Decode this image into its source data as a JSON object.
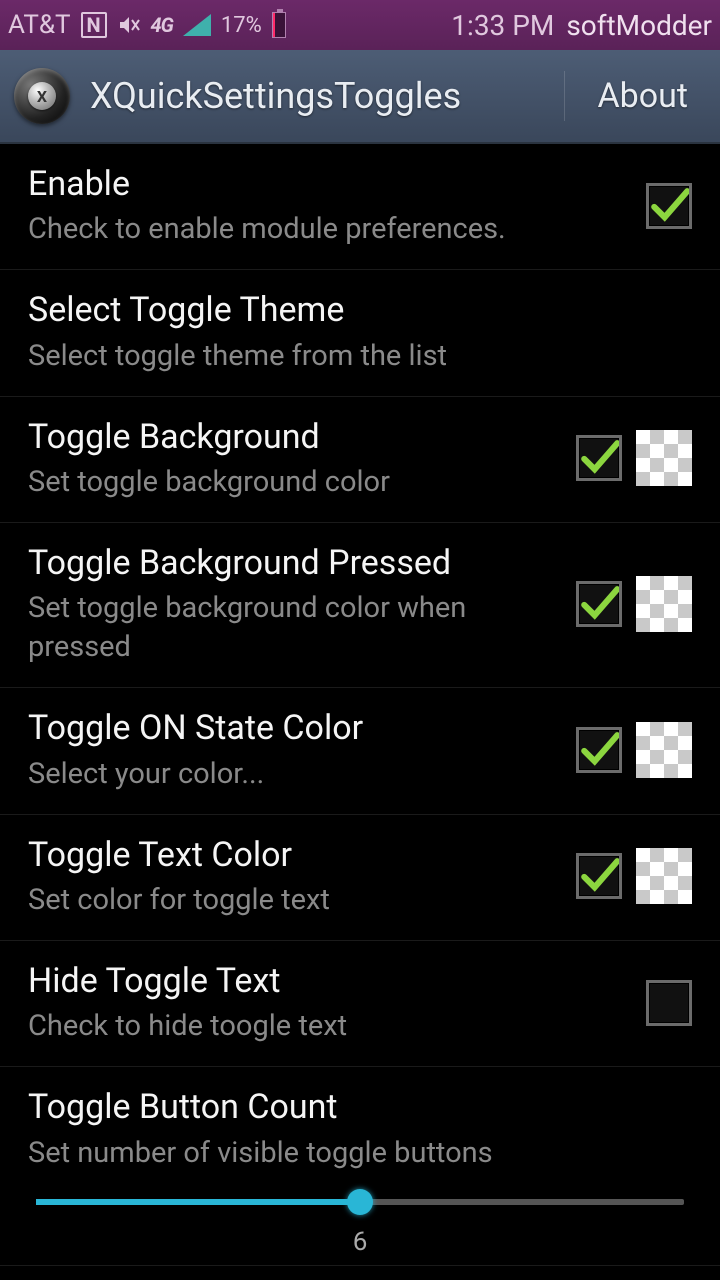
{
  "status_bar": {
    "carrier": "AT&T",
    "battery_percent": "17%",
    "time": "1:33 PM",
    "brand": "softModder",
    "network_label": "4G"
  },
  "action_bar": {
    "title": "XQuickSettingsToggles",
    "about_label": "About",
    "icon_letter": "X"
  },
  "rows": {
    "enable": {
      "title": "Enable",
      "sub": "Check to enable module preferences.",
      "checked": true
    },
    "theme": {
      "title": "Select Toggle Theme",
      "sub": "Select toggle theme from the list"
    },
    "bg": {
      "title": "Toggle Background",
      "sub": "Set toggle background color",
      "checked": true
    },
    "bgp": {
      "title": "Toggle Background Pressed",
      "sub": "Set toggle background color when pressed",
      "checked": true
    },
    "on": {
      "title": "Toggle ON State Color",
      "sub": "Select your color...",
      "checked": true
    },
    "text": {
      "title": "Toggle Text Color",
      "sub": "Set color for toggle text",
      "checked": true
    },
    "hide": {
      "title": "Hide Toggle Text",
      "sub": "Check to hide toogle text",
      "checked": false
    },
    "count": {
      "title": "Toggle Button Count",
      "sub": "Set number of visible toggle buttons",
      "value": "6",
      "percent": 50
    }
  },
  "colors": {
    "accent": "#29b6d6",
    "check": "#8cd63f"
  }
}
